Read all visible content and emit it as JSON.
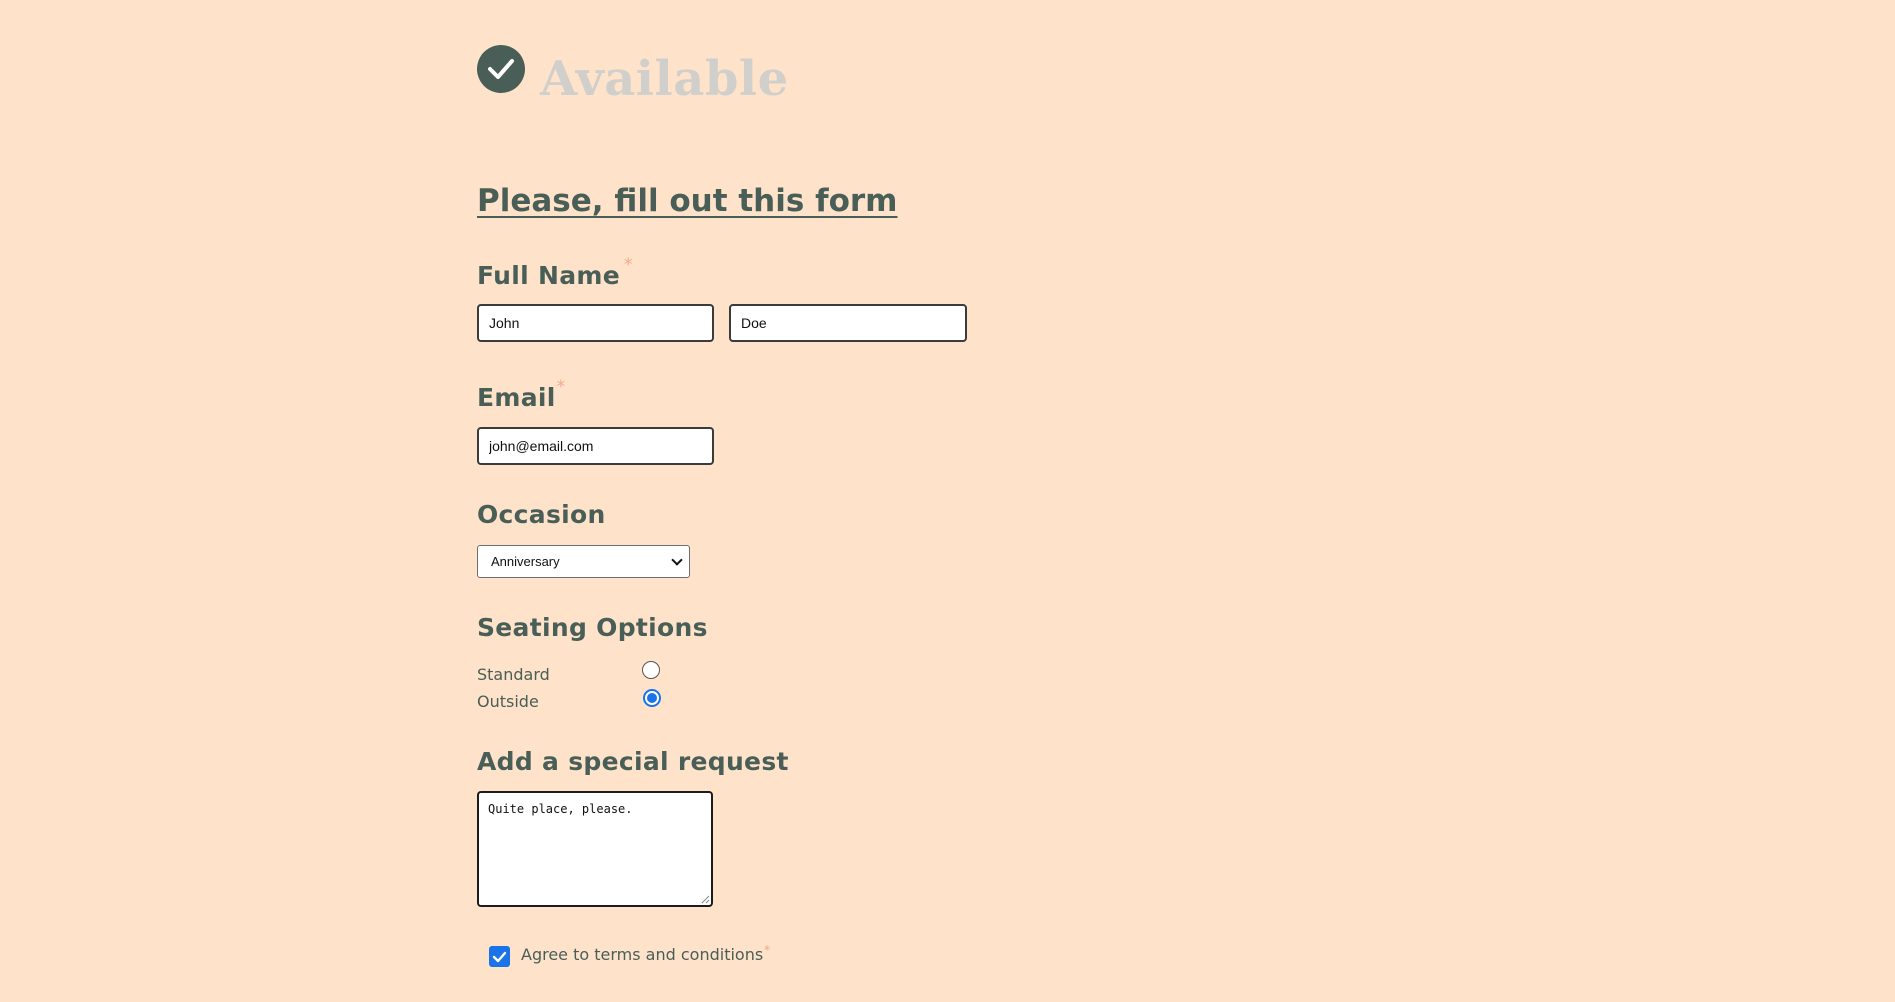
{
  "availability": {
    "icon": "check-circle-icon",
    "status": "Available"
  },
  "form": {
    "title": "Please, fill out this form",
    "full_name": {
      "label": "Full Name",
      "required_mark": "*",
      "first_value": "John",
      "last_value": "Doe"
    },
    "email": {
      "label": "Email",
      "required_mark": "*",
      "value": "john@email.com"
    },
    "occasion": {
      "label": "Occasion",
      "selected": "Anniversary"
    },
    "seating": {
      "label": "Seating Options",
      "options": [
        {
          "label": "Standard",
          "selected": false
        },
        {
          "label": "Outside",
          "selected": true
        }
      ]
    },
    "special_request": {
      "label": "Add a special request",
      "value": "Quite place, please."
    },
    "terms": {
      "label": "Agree to terms and conditions",
      "required_mark": "*",
      "checked": true
    }
  },
  "colors": {
    "background": "#fee3ca",
    "primary": "#495e57",
    "muted_title": "#d1cfcb",
    "required": "#f0a98a",
    "accent": "#1a73e8"
  }
}
